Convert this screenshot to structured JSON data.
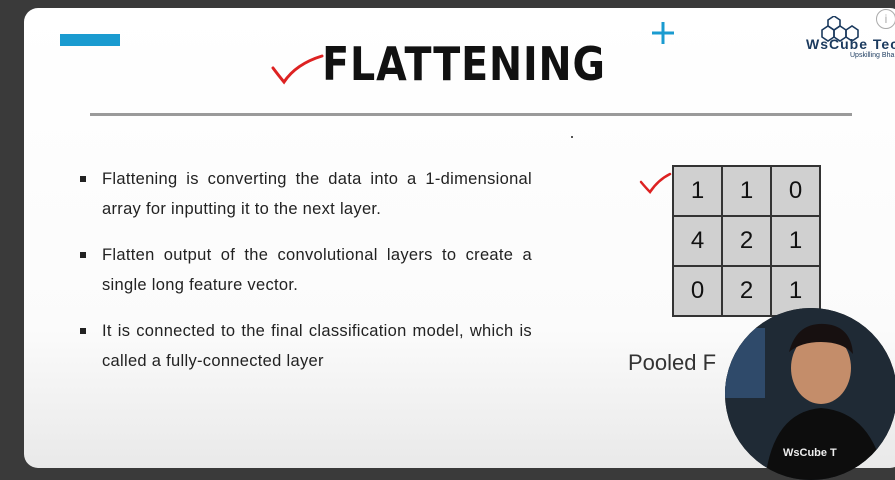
{
  "slide": {
    "title": "FLATTENING",
    "accent_color": "#1a9bd0",
    "bullets": [
      "Flattening is converting the data into a 1-dimensional array for inputting it to the next layer.",
      "Flatten  output of the convolutional layers to create a single long feature vector.",
      "It is connected to the final classification model, which is called a fully-connected layer"
    ],
    "matrix": [
      [
        "1",
        "1",
        "0"
      ],
      [
        "4",
        "2",
        "1"
      ],
      [
        "0",
        "2",
        "1"
      ]
    ],
    "matrix_caption": "Pooled F",
    "annotation_icon": "red-check-mark-icon"
  },
  "logo": {
    "name": "WsCube Tec",
    "tagline": "Upskilling Bha"
  },
  "presenter": {
    "icon": "presenter-webcam",
    "shirt_text": "WsCube T"
  },
  "info": {
    "label": "i"
  }
}
